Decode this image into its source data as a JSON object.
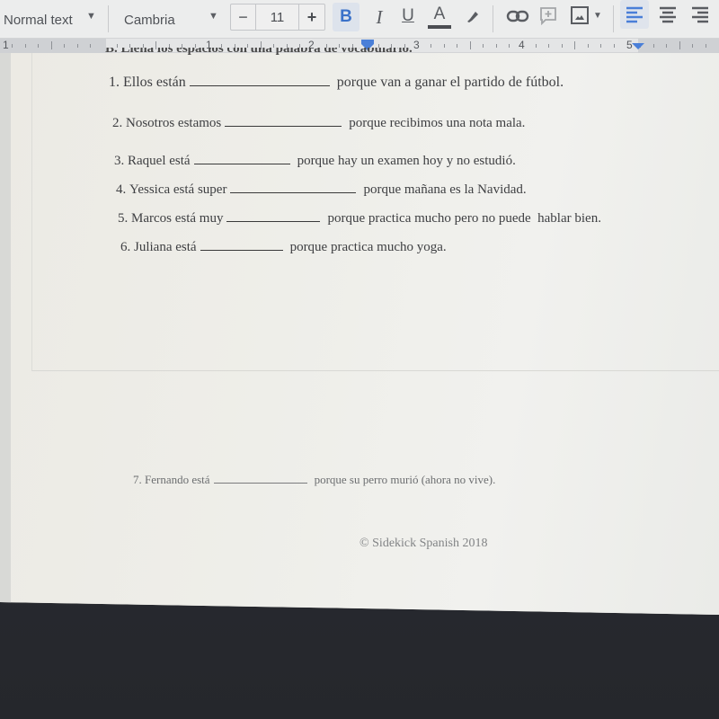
{
  "toolbar": {
    "paragraph_style": "Normal text",
    "font_family": "Cambria",
    "font_size": "11",
    "decrease_size": "−",
    "increase_size": "+",
    "bold": "B",
    "italic": "I",
    "underline": "U",
    "text_color": "A",
    "accent_color": "#3b72c9",
    "icons": [
      "highlighter-icon",
      "link-icon",
      "add-comment-icon",
      "insert-image-icon",
      "align-left-icon",
      "align-center-icon",
      "align-right-icon"
    ]
  },
  "ruler": {
    "left_edge_label": "1",
    "numbers": [
      "1",
      "2",
      "3",
      "4",
      "5"
    ]
  },
  "document": {
    "section_heading": "B. Llena los espacios con una palabra de vocabulario.",
    "items": [
      {
        "number": "1.",
        "prefix": "Ellos están",
        "suffix": "porque van a ganar el partido de fútbol."
      },
      {
        "number": "2.",
        "prefix": "Nosotros estamos",
        "suffix": "porque recibimos una nota mala."
      },
      {
        "number": "3.",
        "prefix": "Raquel está",
        "suffix": "porque hay un examen hoy y no estudió."
      },
      {
        "number": "4.",
        "prefix": "Yessica está super",
        "suffix": "porque mañana es la Navidad."
      },
      {
        "number": "5.",
        "prefix": "Marcos está muy",
        "suffix": "porque practica mucho pero no puede  hablar bien."
      },
      {
        "number": "6.",
        "prefix": "Juliana está",
        "suffix": "porque practica mucho yoga."
      },
      {
        "number": "7.",
        "prefix": "Fernando está",
        "suffix": "porque su perro murió (ahora no vive)."
      }
    ],
    "copyright": "© Sidekick Spanish 2018"
  }
}
